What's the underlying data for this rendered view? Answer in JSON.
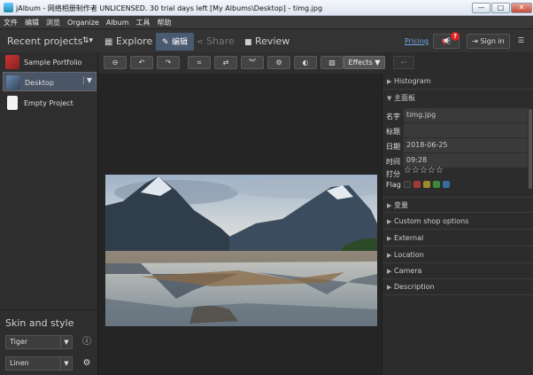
{
  "window": {
    "title": "jAlbum - 网络相册制作者 UNLICENSED. 30 trial days left [My Albums\\Desktop] - timg.jpg",
    "controls": [
      "—",
      "□",
      "✕"
    ]
  },
  "menu": [
    "文件",
    "编辑",
    "浏览",
    "Organize",
    "Album",
    "工具",
    "帮助"
  ],
  "header": {
    "recent_projects": "Recent projects",
    "tabs": [
      {
        "label": "Explore"
      },
      {
        "label": "编辑"
      },
      {
        "label": "Share"
      },
      {
        "label": "Review"
      }
    ],
    "pricing": "Pricing",
    "notification_count": "?",
    "sign_in": "Sign in"
  },
  "projects": [
    {
      "label": "Sample Portfolio"
    },
    {
      "label": "Desktop",
      "selected": true
    },
    {
      "label": "Empty Project"
    }
  ],
  "skin_panel": {
    "heading": "Skin and style",
    "skin": "Tiger",
    "style": "Linen"
  },
  "toolbar": {
    "effects": "Effects"
  },
  "right": {
    "sections_top": [
      "Histogram",
      "主面板"
    ],
    "fields": [
      {
        "label": "名字",
        "value": "timg.jpg"
      },
      {
        "label": "标题",
        "value": ""
      },
      {
        "label": "日期",
        "value": "2018-06-25"
      },
      {
        "label": "时间",
        "value": "09:28"
      }
    ],
    "rating_label": "打分",
    "flag_label": "Flag",
    "flag_colors": [
      "#333333",
      "#a33a3a",
      "#9a8a2a",
      "#3a8a3a",
      "#3a6a9a"
    ],
    "sections_bottom": [
      "变量",
      "Custom shop options",
      "External",
      "Location",
      "Camera",
      "Description"
    ]
  }
}
